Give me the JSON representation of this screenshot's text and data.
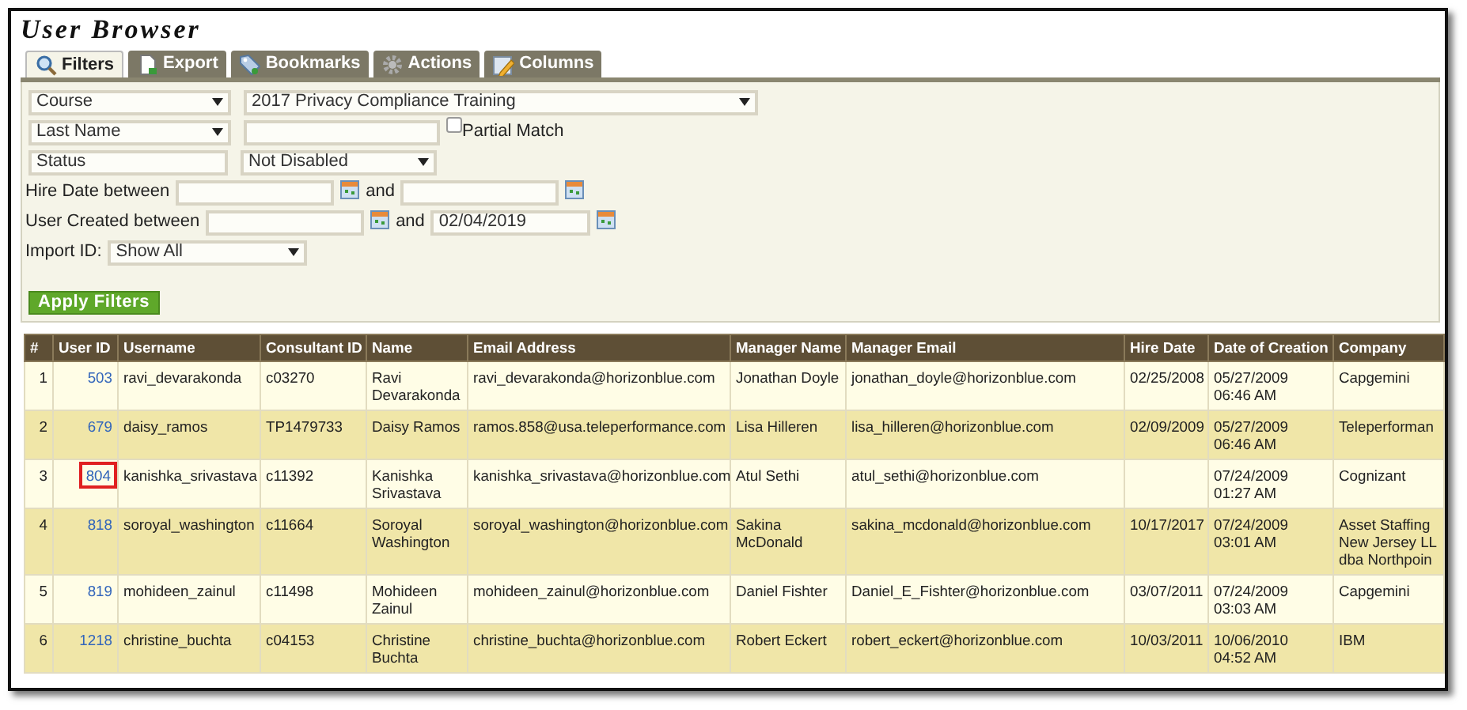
{
  "title": "User Browser",
  "tabs": [
    {
      "label": "Filters",
      "selected": true
    },
    {
      "label": "Export",
      "selected": false
    },
    {
      "label": "Bookmarks",
      "selected": false
    },
    {
      "label": "Actions",
      "selected": false
    },
    {
      "label": "Columns",
      "selected": false
    }
  ],
  "filters": {
    "course": {
      "field": "Course",
      "value": "2017 Privacy Compliance Training"
    },
    "name": {
      "field": "Last Name",
      "partial_match_label": "Partial Match",
      "partial_match_checked": false
    },
    "status": {
      "field": "Status",
      "value": "Not Disabled"
    },
    "hire_date": {
      "label": "Hire Date between",
      "and": "and"
    },
    "user_created": {
      "label": "User Created between",
      "and": "and",
      "to": "02/04/2019"
    },
    "import_id": {
      "label": "Import ID:",
      "value": "Show All"
    },
    "apply_button": "Apply Filters"
  },
  "table": {
    "columns": [
      "#",
      "User ID",
      "Username",
      "Consultant ID",
      "Name",
      "Email Address",
      "Manager Name",
      "Manager Email",
      "Hire Date",
      "Date of Creation",
      "Company"
    ],
    "rows": [
      {
        "highlighted": false,
        "cells": [
          "1",
          "503",
          "ravi_devarakonda",
          "c03270",
          "Ravi\nDevarakonda",
          "ravi_devarakonda@horizonblue.com",
          "Jonathan Doyle",
          "jonathan_doyle@horizonblue.com",
          "02/25/2008",
          "05/27/2009\n06:46 AM",
          "Capgemini"
        ]
      },
      {
        "highlighted": false,
        "cells": [
          "2",
          "679",
          "daisy_ramos",
          "TP1479733",
          "Daisy Ramos",
          "ramos.858@usa.teleperformance.com",
          "Lisa Hilleren",
          "lisa_hilleren@horizonblue.com",
          "02/09/2009",
          "05/27/2009\n06:46 AM",
          "Teleperforman"
        ]
      },
      {
        "highlighted": true,
        "cells": [
          "3",
          "804",
          "kanishka_srivastava",
          "c11392",
          "Kanishka\nSrivastava",
          "kanishka_srivastava@horizonblue.com",
          "Atul Sethi",
          "atul_sethi@horizonblue.com",
          "",
          "07/24/2009\n01:27 AM",
          "Cognizant"
        ]
      },
      {
        "highlighted": false,
        "cells": [
          "4",
          "818",
          "soroyal_washington",
          "c11664",
          "Soroyal\nWashington",
          "soroyal_washington@horizonblue.com",
          "Sakina\nMcDonald",
          "sakina_mcdonald@horizonblue.com",
          "10/17/2017",
          "07/24/2009\n03:01 AM",
          "Asset Staffing\nNew Jersey LL\ndba Northpoin"
        ]
      },
      {
        "highlighted": false,
        "cells": [
          "5",
          "819",
          "mohideen_zainul",
          "c11498",
          "Mohideen\nZainul",
          "mohideen_zainul@horizonblue.com",
          "Daniel Fishter",
          "Daniel_E_Fishter@horizonblue.com",
          "03/07/2011",
          "07/24/2009\n03:03 AM",
          "Capgemini"
        ]
      },
      {
        "highlighted": false,
        "cells": [
          "6",
          "1218",
          "christine_buchta",
          "c04153",
          "Christine\nBuchta",
          "christine_buchta@horizonblue.com",
          "Robert Eckert",
          "robert_eckert@horizonblue.com",
          "10/03/2011",
          "10/06/2010\n04:52 AM",
          "IBM"
        ]
      }
    ]
  }
}
